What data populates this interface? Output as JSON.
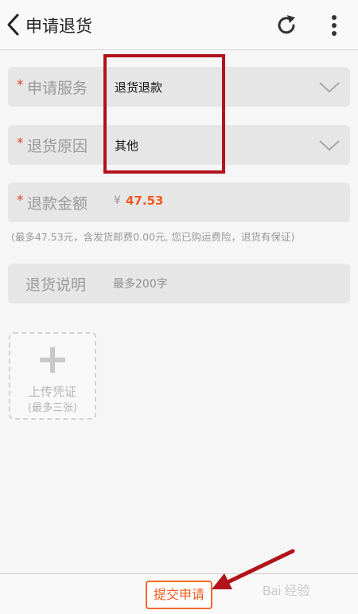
{
  "header": {
    "title": "申请退货",
    "back_icon": "chevron-left-icon",
    "refresh_icon": "refresh-icon",
    "more_icon": "more-vertical-icon"
  },
  "form": {
    "required_mark": "*",
    "service": {
      "label": "申请服务",
      "value": "退货退款"
    },
    "reason": {
      "label": "退货原因",
      "value": "其他"
    },
    "refund": {
      "label": "退款金额",
      "currency": "¥",
      "amount": "47.53"
    },
    "refund_note": "(最多47.53元，含发货邮费0.00元, 您已购运费险，退货有保证)",
    "description": {
      "label": "退货说明",
      "placeholder": "最多200字"
    },
    "upload": {
      "line1": "上传凭证",
      "line2": "(最多三张)"
    }
  },
  "footer": {
    "submit_label": "提交申请",
    "watermark": "Bai 经验"
  },
  "colors": {
    "accent": "#ef5a1d",
    "required": "#e0462d",
    "annotation": "#b0131c"
  }
}
